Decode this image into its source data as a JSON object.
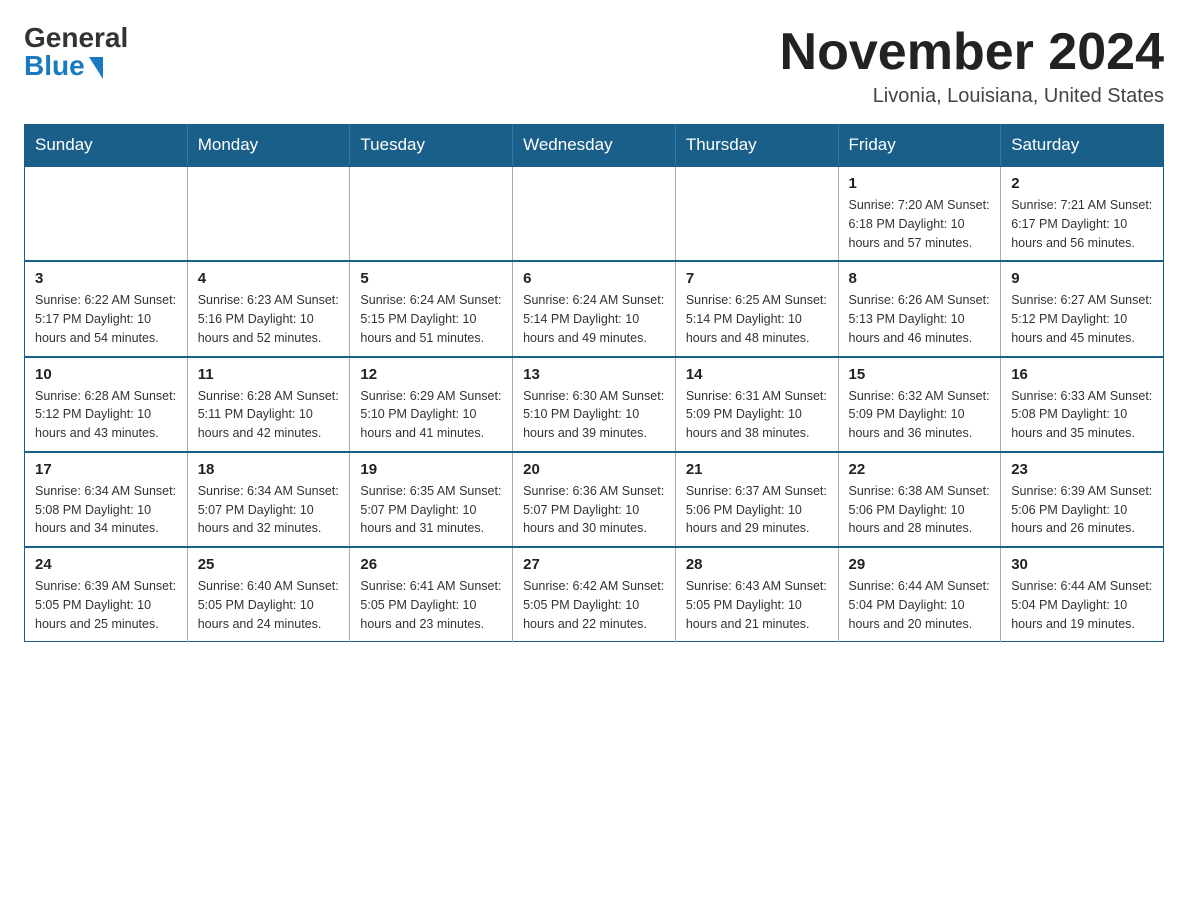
{
  "header": {
    "logo": {
      "general": "General",
      "blue": "Blue",
      "triangle": true
    },
    "title": "November 2024",
    "location": "Livonia, Louisiana, United States"
  },
  "weekdays": [
    "Sunday",
    "Monday",
    "Tuesday",
    "Wednesday",
    "Thursday",
    "Friday",
    "Saturday"
  ],
  "weeks": [
    [
      {
        "day": "",
        "info": ""
      },
      {
        "day": "",
        "info": ""
      },
      {
        "day": "",
        "info": ""
      },
      {
        "day": "",
        "info": ""
      },
      {
        "day": "",
        "info": ""
      },
      {
        "day": "1",
        "info": "Sunrise: 7:20 AM\nSunset: 6:18 PM\nDaylight: 10 hours and 57 minutes."
      },
      {
        "day": "2",
        "info": "Sunrise: 7:21 AM\nSunset: 6:17 PM\nDaylight: 10 hours and 56 minutes."
      }
    ],
    [
      {
        "day": "3",
        "info": "Sunrise: 6:22 AM\nSunset: 5:17 PM\nDaylight: 10 hours and 54 minutes."
      },
      {
        "day": "4",
        "info": "Sunrise: 6:23 AM\nSunset: 5:16 PM\nDaylight: 10 hours and 52 minutes."
      },
      {
        "day": "5",
        "info": "Sunrise: 6:24 AM\nSunset: 5:15 PM\nDaylight: 10 hours and 51 minutes."
      },
      {
        "day": "6",
        "info": "Sunrise: 6:24 AM\nSunset: 5:14 PM\nDaylight: 10 hours and 49 minutes."
      },
      {
        "day": "7",
        "info": "Sunrise: 6:25 AM\nSunset: 5:14 PM\nDaylight: 10 hours and 48 minutes."
      },
      {
        "day": "8",
        "info": "Sunrise: 6:26 AM\nSunset: 5:13 PM\nDaylight: 10 hours and 46 minutes."
      },
      {
        "day": "9",
        "info": "Sunrise: 6:27 AM\nSunset: 5:12 PM\nDaylight: 10 hours and 45 minutes."
      }
    ],
    [
      {
        "day": "10",
        "info": "Sunrise: 6:28 AM\nSunset: 5:12 PM\nDaylight: 10 hours and 43 minutes."
      },
      {
        "day": "11",
        "info": "Sunrise: 6:28 AM\nSunset: 5:11 PM\nDaylight: 10 hours and 42 minutes."
      },
      {
        "day": "12",
        "info": "Sunrise: 6:29 AM\nSunset: 5:10 PM\nDaylight: 10 hours and 41 minutes."
      },
      {
        "day": "13",
        "info": "Sunrise: 6:30 AM\nSunset: 5:10 PM\nDaylight: 10 hours and 39 minutes."
      },
      {
        "day": "14",
        "info": "Sunrise: 6:31 AM\nSunset: 5:09 PM\nDaylight: 10 hours and 38 minutes."
      },
      {
        "day": "15",
        "info": "Sunrise: 6:32 AM\nSunset: 5:09 PM\nDaylight: 10 hours and 36 minutes."
      },
      {
        "day": "16",
        "info": "Sunrise: 6:33 AM\nSunset: 5:08 PM\nDaylight: 10 hours and 35 minutes."
      }
    ],
    [
      {
        "day": "17",
        "info": "Sunrise: 6:34 AM\nSunset: 5:08 PM\nDaylight: 10 hours and 34 minutes."
      },
      {
        "day": "18",
        "info": "Sunrise: 6:34 AM\nSunset: 5:07 PM\nDaylight: 10 hours and 32 minutes."
      },
      {
        "day": "19",
        "info": "Sunrise: 6:35 AM\nSunset: 5:07 PM\nDaylight: 10 hours and 31 minutes."
      },
      {
        "day": "20",
        "info": "Sunrise: 6:36 AM\nSunset: 5:07 PM\nDaylight: 10 hours and 30 minutes."
      },
      {
        "day": "21",
        "info": "Sunrise: 6:37 AM\nSunset: 5:06 PM\nDaylight: 10 hours and 29 minutes."
      },
      {
        "day": "22",
        "info": "Sunrise: 6:38 AM\nSunset: 5:06 PM\nDaylight: 10 hours and 28 minutes."
      },
      {
        "day": "23",
        "info": "Sunrise: 6:39 AM\nSunset: 5:06 PM\nDaylight: 10 hours and 26 minutes."
      }
    ],
    [
      {
        "day": "24",
        "info": "Sunrise: 6:39 AM\nSunset: 5:05 PM\nDaylight: 10 hours and 25 minutes."
      },
      {
        "day": "25",
        "info": "Sunrise: 6:40 AM\nSunset: 5:05 PM\nDaylight: 10 hours and 24 minutes."
      },
      {
        "day": "26",
        "info": "Sunrise: 6:41 AM\nSunset: 5:05 PM\nDaylight: 10 hours and 23 minutes."
      },
      {
        "day": "27",
        "info": "Sunrise: 6:42 AM\nSunset: 5:05 PM\nDaylight: 10 hours and 22 minutes."
      },
      {
        "day": "28",
        "info": "Sunrise: 6:43 AM\nSunset: 5:05 PM\nDaylight: 10 hours and 21 minutes."
      },
      {
        "day": "29",
        "info": "Sunrise: 6:44 AM\nSunset: 5:04 PM\nDaylight: 10 hours and 20 minutes."
      },
      {
        "day": "30",
        "info": "Sunrise: 6:44 AM\nSunset: 5:04 PM\nDaylight: 10 hours and 19 minutes."
      }
    ]
  ]
}
